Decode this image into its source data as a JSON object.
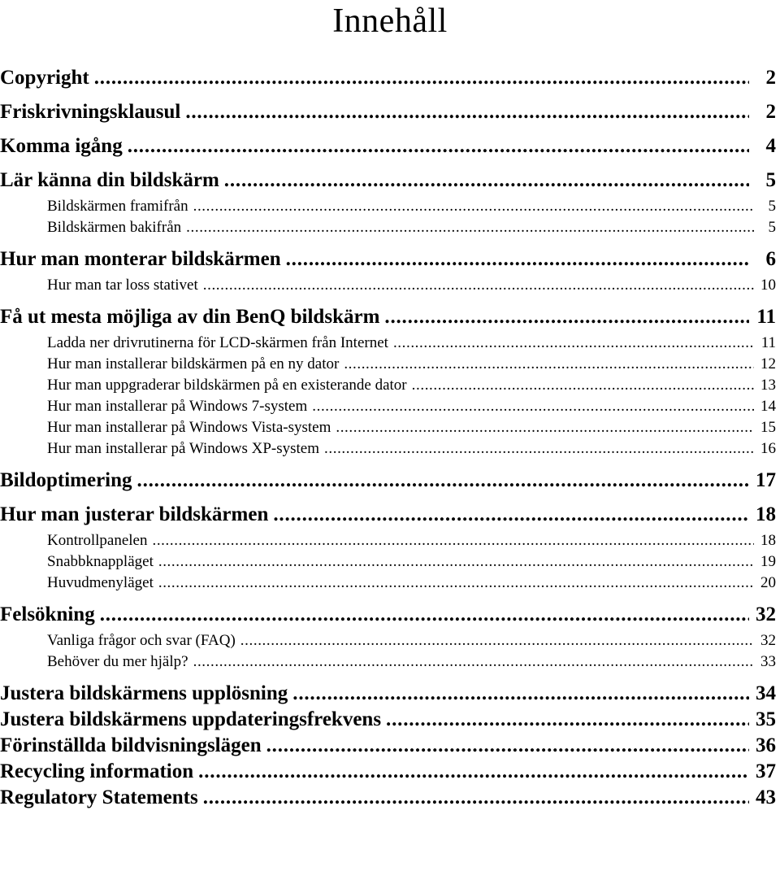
{
  "document": {
    "title": "Innehåll",
    "language": "sv"
  },
  "toc": {
    "entries": [
      {
        "label": "Copyright",
        "page": "2",
        "level": 1
      },
      {
        "label": "Friskrivningsklausul",
        "page": "2",
        "level": 1
      },
      {
        "label": "Komma igång",
        "page": "4",
        "level": 1
      },
      {
        "label": "Lär känna din bildskärm",
        "page": "5",
        "level": 1
      },
      {
        "label": "Bildskärmen framifrån",
        "page": "5",
        "level": 2
      },
      {
        "label": "Bildskärmen bakifrån",
        "page": "5",
        "level": 2
      },
      {
        "label": "Hur man monterar bildskärmen",
        "page": "6",
        "level": 1
      },
      {
        "label": "Hur man tar loss stativet",
        "page": "10",
        "level": 2
      },
      {
        "label": "Få ut mesta möjliga av din BenQ bildskärm",
        "page": "11",
        "level": 1
      },
      {
        "label": "Ladda ner drivrutinerna för LCD-skärmen från Internet",
        "page": "11",
        "level": 2
      },
      {
        "label": "Hur man installerar bildskärmen på en ny dator",
        "page": "12",
        "level": 2
      },
      {
        "label": "Hur man uppgraderar bildskärmen på en existerande dator",
        "page": "13",
        "level": 2
      },
      {
        "label": "Hur man installerar på Windows 7-system",
        "page": "14",
        "level": 2
      },
      {
        "label": "Hur man installerar på Windows Vista-system",
        "page": "15",
        "level": 2
      },
      {
        "label": "Hur man installerar på Windows XP-system",
        "page": "16",
        "level": 2
      },
      {
        "label": "Bildoptimering",
        "page": "17",
        "level": 1
      },
      {
        "label": "Hur man justerar bildskärmen",
        "page": "18",
        "level": 1
      },
      {
        "label": "Kontrollpanelen",
        "page": "18",
        "level": 2
      },
      {
        "label": "Snabbknappläget",
        "page": "19",
        "level": 2
      },
      {
        "label": "Huvudmenyläget",
        "page": "20",
        "level": 2
      },
      {
        "label": "Felsökning",
        "page": "32",
        "level": 1
      },
      {
        "label": "Vanliga frågor och svar (FAQ)",
        "page": "32",
        "level": 2
      },
      {
        "label": "Behöver du mer hjälp?",
        "page": "33",
        "level": 2
      },
      {
        "label": "Justera bildskärmens upplösning",
        "page": "34",
        "level": 1
      },
      {
        "label": "Justera bildskärmens uppdateringsfrekvens",
        "page": "35",
        "level": 1
      },
      {
        "label": "Förinställda bildvisningslägen",
        "page": "36",
        "level": 1
      },
      {
        "label": "Recycling information",
        "page": "37",
        "level": 1
      },
      {
        "label": "Regulatory Statements",
        "page": "43",
        "level": 1
      }
    ]
  },
  "style": {
    "text_color": "#000000",
    "background_color": "#ffffff"
  }
}
